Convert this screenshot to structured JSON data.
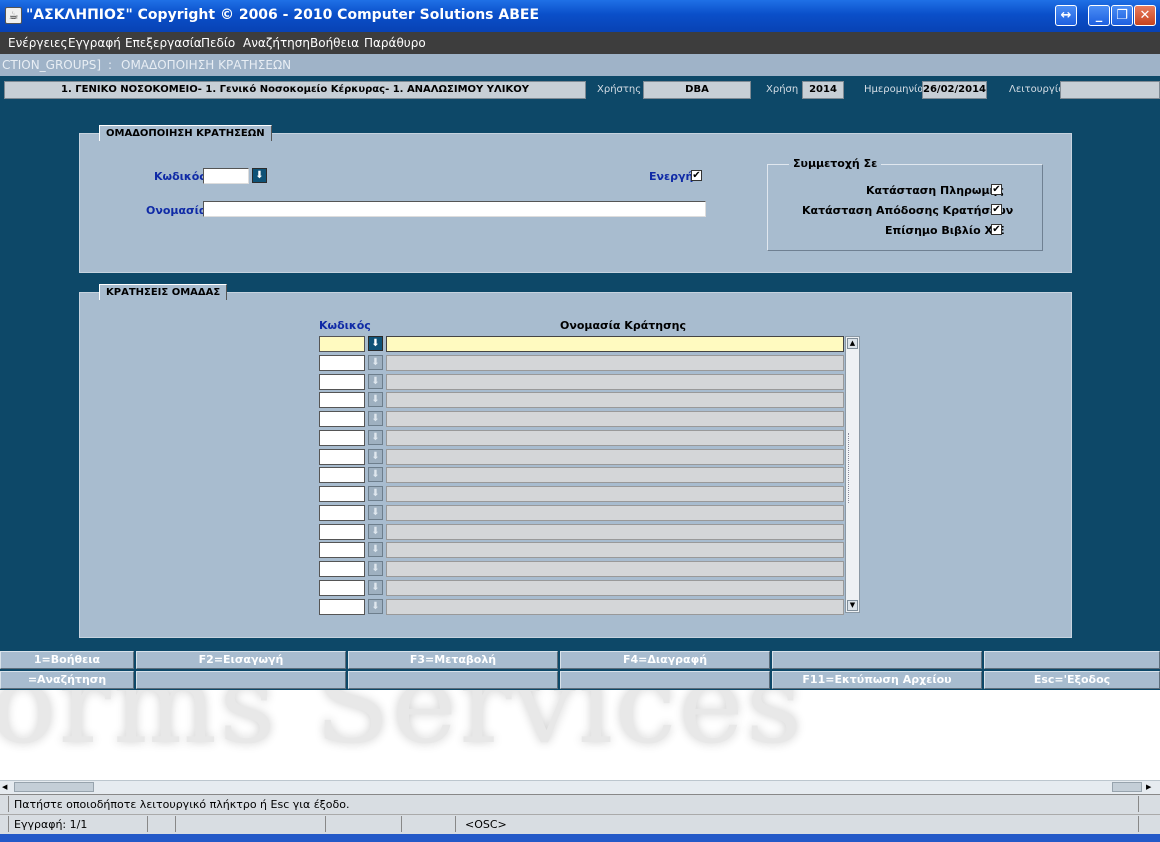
{
  "window": {
    "title": "\"ΑΣΚΛΗΠΙΟΣ\" Copyright © 2006 - 2010 Computer Solutions ΑΒΕΕ",
    "app_icon": "java-cup-icon"
  },
  "menu": [
    "Ενέργειες",
    "Εγγραφή",
    "Επεξεργασία",
    "Πεδίο",
    "Αναζήτηση",
    "Βοήθεια",
    "Παράθυρο"
  ],
  "breadcrumb": {
    "left": "CTION_GROUPS]",
    "sep": ":",
    "right": "ΟΜΑΔΟΠΟΙΗΣΗ ΚΡΑΤΗΣΕΩΝ"
  },
  "info": {
    "org": "1. ΓΕΝΙΚΟ ΝΟΣΟΚΟΜΕΙΟ- 1. Γενικό Νοσοκομείο Κέρκυρας- 1. ΑΝΑΛΩΣΙΜΟΥ ΥΛΙΚΟΥ",
    "user_label": "Χρήστης",
    "user": "DBA",
    "year_label": "Χρήση",
    "year": "2014",
    "date_label": "Ημερομηνία",
    "date": "26/02/2014",
    "function_label": "Λειτουργία",
    "function": ""
  },
  "header_panel": {
    "title": "ΟΜΑΔΟΠΟΙΗΣΗ ΚΡΑΤΗΣΕΩΝ",
    "code_label": "Κωδικός",
    "code_value": "",
    "name_label": "Ονομασία",
    "name_value": "",
    "active_label": "Ενεργή",
    "active_checked": "✔",
    "participation": {
      "title": "Συμμετοχή Σε",
      "items": [
        {
          "label": "Κατάσταση Πληρωμής",
          "checked": "✔"
        },
        {
          "label": "Κατάσταση Απόδοσης Κρατήσεων",
          "checked": "✔"
        },
        {
          "label": "Επίσημο Βιβλίο Χ/Ε",
          "checked": "✔"
        }
      ]
    }
  },
  "detail_panel": {
    "title": "ΚΡΑΤΗΣΕΙΣ ΟΜΑΔΑΣ",
    "col_code": "Κωδικός",
    "col_name": "Ονομασία Κράτησης"
  },
  "fkeys_row1": [
    "1=Βοήθεια",
    "F2=Εισαγωγή",
    "F3=Μεταβολή",
    "F4=Διαγραφή",
    "",
    ""
  ],
  "fkeys_row2": [
    "=Αναζήτηση",
    "",
    "",
    "",
    "F11=Εκτύπωση Αρχείου",
    "Esc='Εξοδος"
  ],
  "watermark": "orms Services",
  "status": {
    "message": "Πατήστε οποιοδήποτε λειτουργικό πλήκτρο ή Esc για έξοδο.",
    "record": "Εγγραφή: 1/1",
    "mode": "<OSC>"
  }
}
